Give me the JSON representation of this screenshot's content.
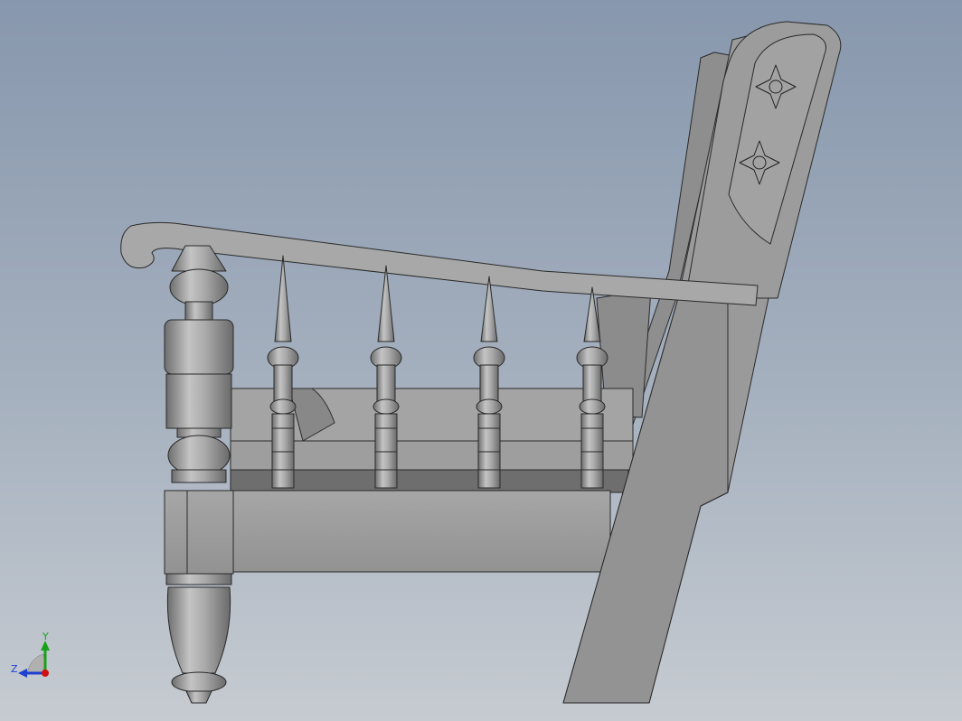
{
  "view": {
    "background_top": "#8797ad",
    "background_bottom": "#c6cbd1"
  },
  "model": {
    "part_color": "#9a9a9a",
    "edge_color": "#2a2a2a",
    "decoration": "star-flower",
    "decoration_count": 2,
    "spindle_count": 4
  },
  "triad": {
    "y_label": "Y",
    "z_label": "Z",
    "y_color": "#1aa01a",
    "z_color": "#1f3fd0",
    "x_color": "#d01010"
  }
}
